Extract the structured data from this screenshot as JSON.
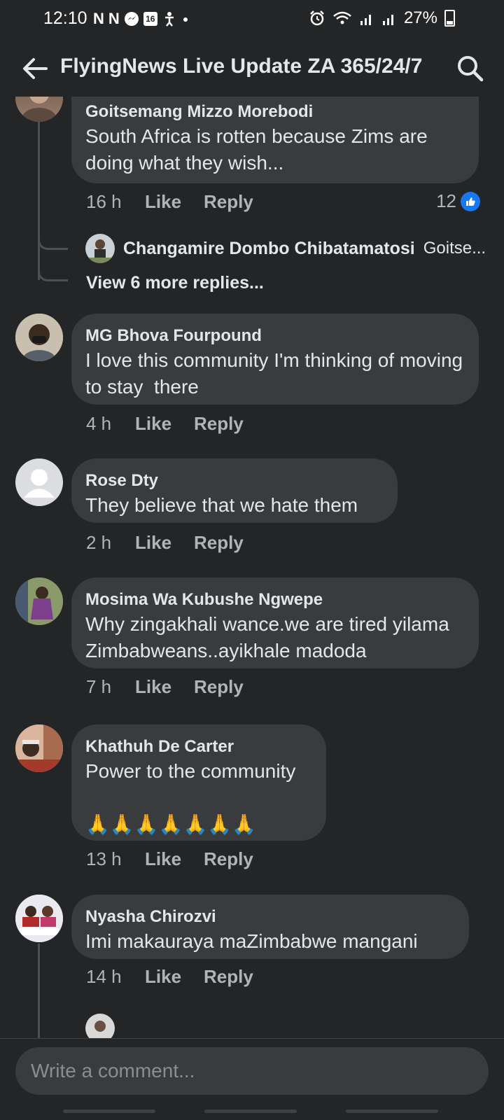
{
  "status_bar": {
    "time": "12:10",
    "notif_icons": [
      "N",
      "N"
    ],
    "calendar_day": "16",
    "battery": "27%"
  },
  "header": {
    "title": "FlyingNews Live Update ZA 365/24/7"
  },
  "comments": [
    {
      "author": "Goitsemang Mizzo Morebodi",
      "text": "South Africa is rotten because Zims are doing what they wish...",
      "time": "16 h",
      "like_label": "Like",
      "reply_label": "Reply",
      "reaction_count": "12",
      "reply_preview": {
        "author": "Changamire Dombo Chibatamatosi",
        "text": "Goitse..."
      },
      "view_more": "View 6 more replies..."
    },
    {
      "author": "MG Bhova Fourpound",
      "text": "I love this community I'm thinking of moving to stay  there",
      "time": "4 h",
      "like_label": "Like",
      "reply_label": "Reply"
    },
    {
      "author": "Rose Dty",
      "text": "They believe that we hate them",
      "time": "2 h",
      "like_label": "Like",
      "reply_label": "Reply"
    },
    {
      "author": "Mosima Wa Kubushe Ngwepe",
      "text": "Why zingakhali wance.we are tired yilama Zimbabweans..ayikhale madoda",
      "time": "7 h",
      "like_label": "Like",
      "reply_label": "Reply"
    },
    {
      "author": "Khathuh De Carter",
      "text": "Power to the community\n\n🙏🙏🙏🙏🙏🙏🙏",
      "time": "13 h",
      "like_label": "Like",
      "reply_label": "Reply"
    },
    {
      "author": "Nyasha Chirozvi",
      "text": "Imi makauraya maZimbabwe mangani",
      "time": "14 h",
      "like_label": "Like",
      "reply_label": "Reply"
    }
  ],
  "composer": {
    "placeholder": "Write a comment..."
  }
}
